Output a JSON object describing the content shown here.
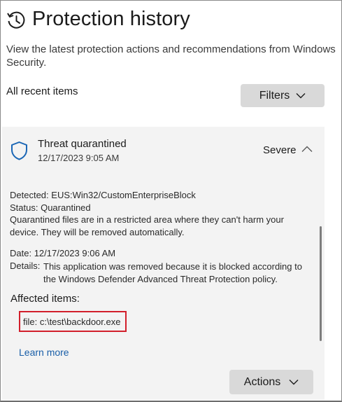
{
  "page": {
    "title": "Protection history",
    "subtitle": "View the latest protection actions and recommendations from Windows Security.",
    "recent_label": "All recent items",
    "filters_label": "Filters"
  },
  "icons": {
    "history": "history-clock-icon",
    "shield": "shield-icon",
    "collapse": "chevron-up-icon",
    "dropdown": "chevron-down-icon"
  },
  "colors": {
    "accent": "#1a5fa8",
    "highlight_border": "#d21f2b",
    "card_background": "#f3f3f3",
    "button_background": "#d9d9d9"
  },
  "threat": {
    "title": "Threat quarantined",
    "timestamp": "12/17/2023 9:05 AM",
    "severity": "Severe",
    "detected_label": "Detected:",
    "detected_value": "EUS:Win32/CustomEnterpriseBlock",
    "status_label": "Status:",
    "status_value": "Quarantined",
    "status_description": "Quarantined files are in a restricted area where they can't harm your device. They will be removed automatically.",
    "date_label": "Date:",
    "date_value": "12/17/2023 9:06 AM",
    "details_label": "Details:",
    "details_value": "This application was removed because it is blocked according to the Windows Defender Advanced Threat Protection policy.",
    "affected_label": "Affected items:",
    "affected_items": [
      "file: c:\\test\\backdoor.exe"
    ],
    "learn_more": "Learn more",
    "actions_label": "Actions"
  }
}
